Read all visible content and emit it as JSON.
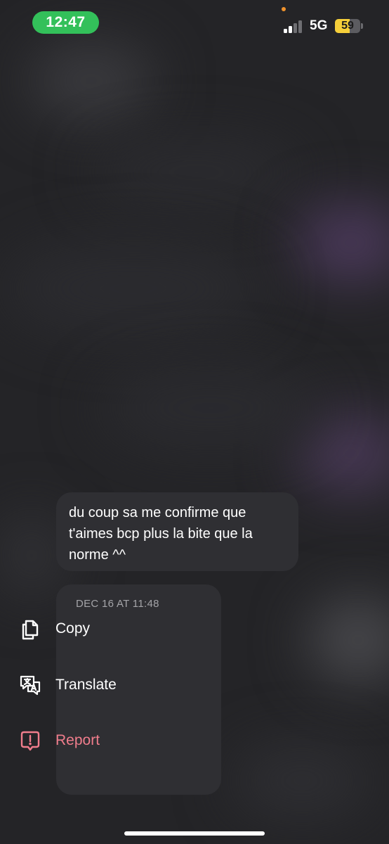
{
  "status_bar": {
    "time": "12:47",
    "network": "5G",
    "battery_level": "59",
    "battery_fraction": 0.59,
    "time_pill_color": "#33c05a",
    "battery_color": "#f5cf3a"
  },
  "message": {
    "text": "du coup sa me confirme que t'aimes bcp plus la bite que la norme ^^"
  },
  "context_menu": {
    "timestamp": "DEC 16 AT 11:48",
    "items": [
      {
        "label": "Copy",
        "icon": "copy-icon"
      },
      {
        "label": "Translate",
        "icon": "translate-icon"
      },
      {
        "label": "Report",
        "icon": "report-icon",
        "color": "#f07d8c"
      }
    ]
  }
}
